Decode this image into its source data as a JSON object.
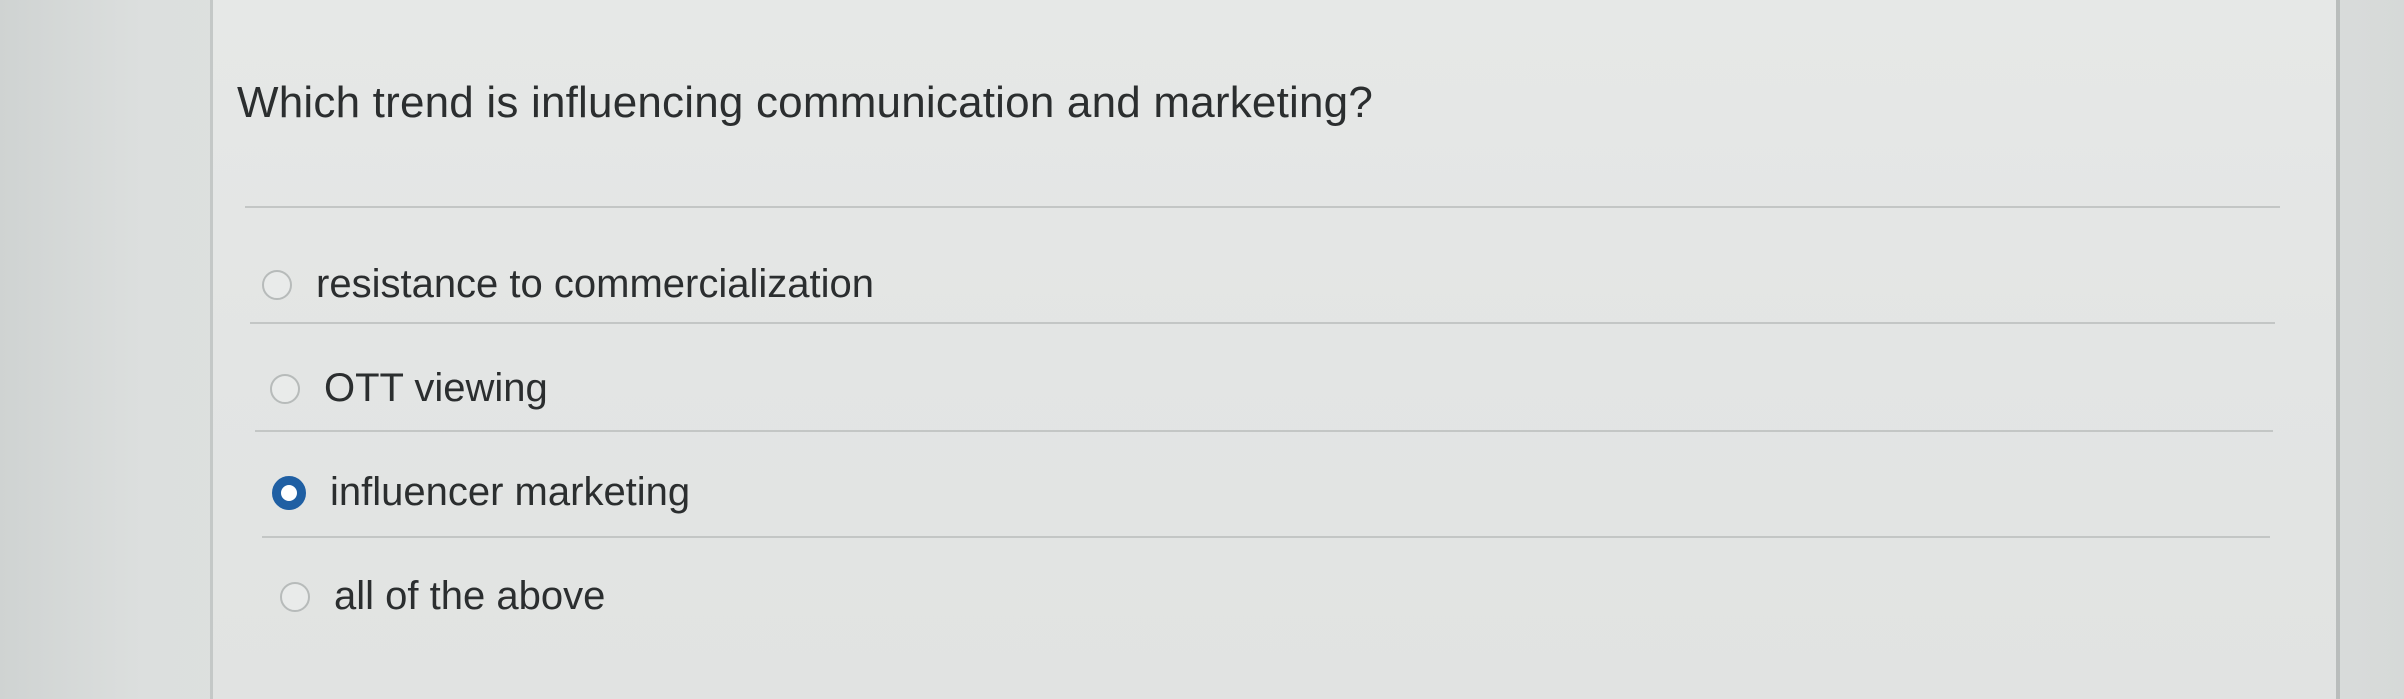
{
  "question": {
    "text": "Which trend is influencing communication and marketing?"
  },
  "options": [
    {
      "label": "resistance to commercialization",
      "selected": false
    },
    {
      "label": "OTT viewing",
      "selected": false
    },
    {
      "label": "influencer marketing",
      "selected": true
    },
    {
      "label": "all of the above",
      "selected": false
    }
  ],
  "colors": {
    "selected_radio": "#1f5fa3",
    "text": "#2b2e2f",
    "background": "#e3e5e4"
  }
}
